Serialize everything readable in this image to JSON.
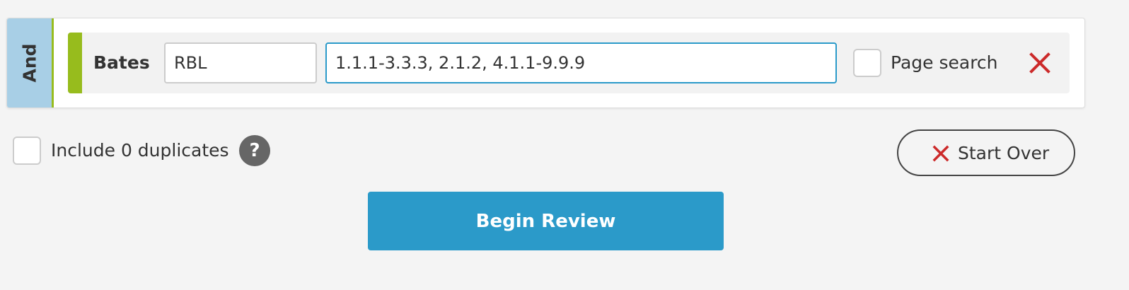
{
  "criteria": {
    "operator": "And",
    "field_label": "Bates",
    "prefix_value": "RBL",
    "range_value": "1.1.1-3.3.3, 2.1.2, 4.1.1-9.9.9",
    "page_search_label": "Page search",
    "page_search_checked": false,
    "remove_icon": "close-icon"
  },
  "options": {
    "include_duplicates_label": "Include 0 duplicates",
    "include_duplicates_checked": false,
    "help_icon_text": "?"
  },
  "actions": {
    "start_over_label": "Start Over",
    "begin_review_label": "Begin Review"
  },
  "colors": {
    "primary_blue": "#2b9ac9",
    "operator_tab": "#a8cfe6",
    "accent_green": "#97bc1d",
    "remove_red": "#cc2a2a",
    "help_gray": "#666666"
  }
}
